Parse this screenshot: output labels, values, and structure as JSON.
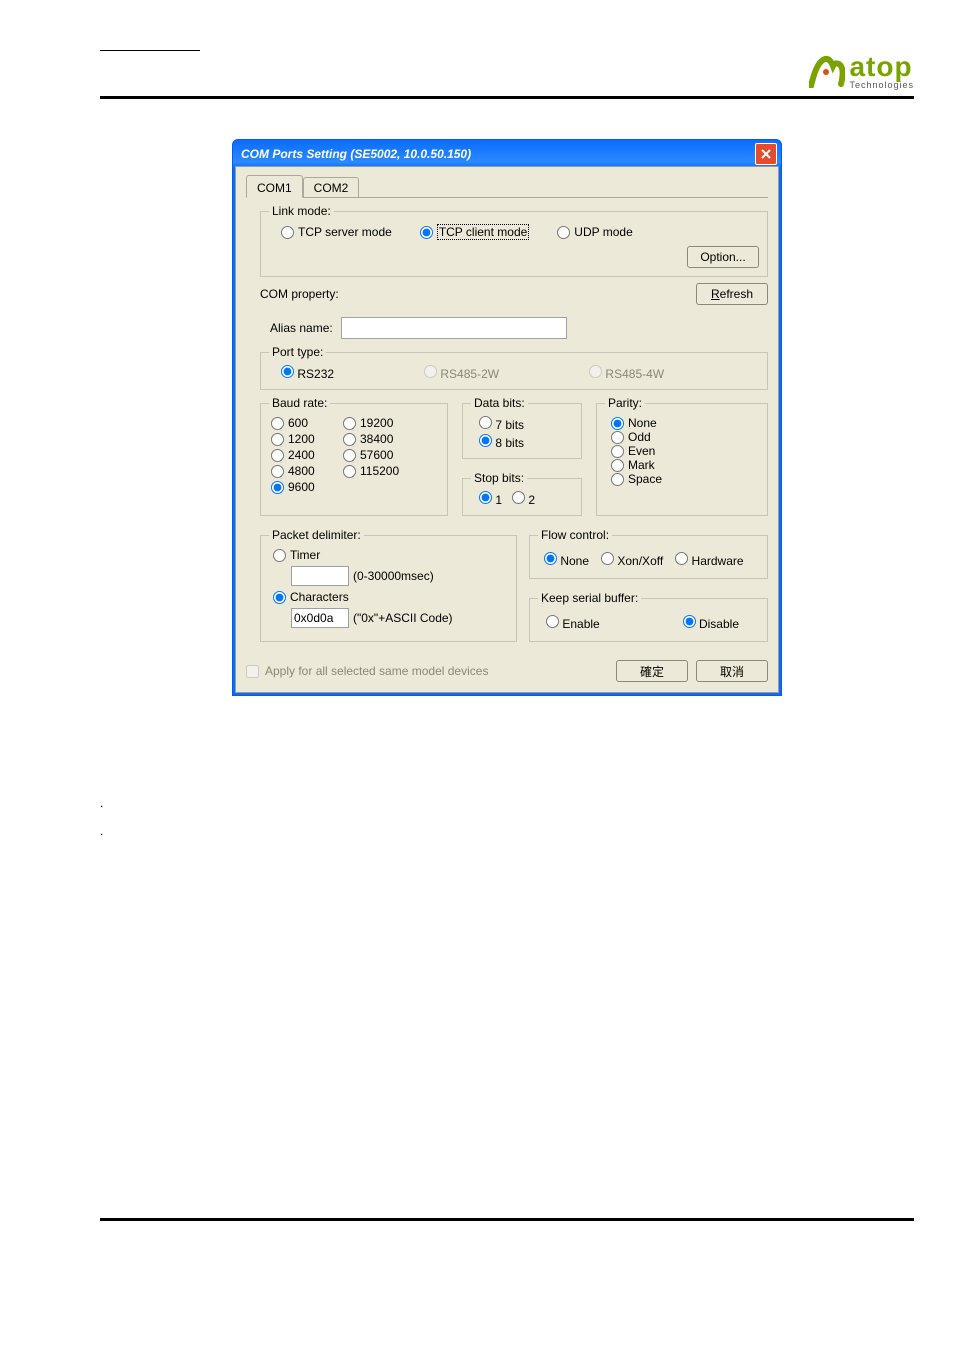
{
  "logo": {
    "brand": "atop",
    "sub": "Technologies"
  },
  "dialog": {
    "title": "COM Ports Setting (SE5002, 10.0.50.150)",
    "tabs": [
      "COM1",
      "COM2"
    ],
    "active_tab": "COM1",
    "link_mode": {
      "legend": "Link mode:",
      "options": {
        "server": "TCP server mode",
        "client": "TCP client mode",
        "udp": "UDP mode"
      },
      "selected": "client",
      "option_btn": "Option..."
    },
    "com_property": {
      "label": "COM property:",
      "refresh_btn": "Refresh",
      "alias_label": "Alias name:",
      "alias_value": ""
    },
    "port_type": {
      "legend": "Port type:",
      "options": {
        "rs232": "RS232",
        "rs485_2w": "RS485-2W",
        "rs485_4w": "RS485-4W"
      },
      "selected": "rs232"
    },
    "baud": {
      "legend": "Baud rate:",
      "col1": [
        "600",
        "1200",
        "2400",
        "4800",
        "9600"
      ],
      "col2": [
        "19200",
        "38400",
        "57600",
        "115200"
      ],
      "selected": "9600"
    },
    "data_bits": {
      "legend": "Data bits:",
      "options": [
        "7 bits",
        "8 bits"
      ],
      "selected": "8 bits"
    },
    "stop_bits": {
      "legend": "Stop bits:",
      "options": [
        "1",
        "2"
      ],
      "selected": "1"
    },
    "parity": {
      "legend": "Parity:",
      "options": [
        "None",
        "Odd",
        "Even",
        "Mark",
        "Space"
      ],
      "selected": "None"
    },
    "packet_delim": {
      "legend": "Packet delimiter:",
      "timer_label": "Timer",
      "timer_value": "",
      "timer_hint": "(0-30000msec)",
      "chars_label": "Characters",
      "chars_value": "0x0d0a",
      "chars_hint": "(\"0x\"+ASCII Code)",
      "selected": "chars"
    },
    "flow_control": {
      "legend": "Flow control:",
      "options": {
        "none": "None",
        "xon": "Xon/Xoff",
        "hw": "Hardware"
      },
      "selected": "none"
    },
    "keep_serial": {
      "legend": "Keep serial buffer:",
      "options": {
        "enable": "Enable",
        "disable": "Disable"
      },
      "selected": "disable"
    },
    "apply_all": "Apply for all selected same model devices",
    "ok_btn": "確定",
    "cancel_btn": "取消"
  },
  "trailing": {
    "dot1": ".",
    "dot2": "."
  }
}
